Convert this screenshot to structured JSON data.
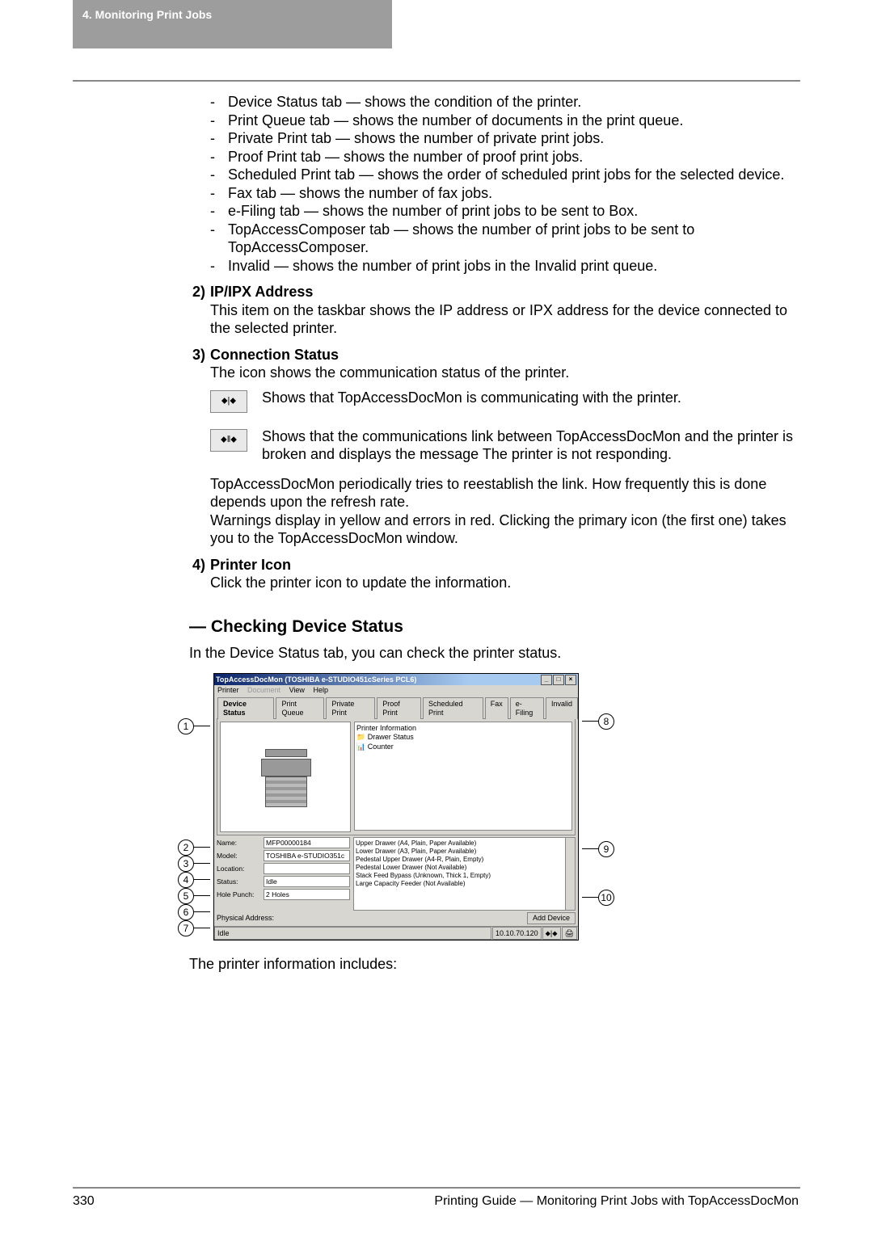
{
  "header": "4. Monitoring Print Jobs",
  "bullets": [
    "Device Status tab — shows the condition of the printer.",
    "Print Queue tab — shows the number of documents in the print queue.",
    "Private Print tab — shows the number of private print jobs.",
    "Proof Print tab — shows the number of proof print jobs.",
    "Scheduled Print tab — shows the order of scheduled print jobs for the selected device.",
    "Fax tab — shows the number of fax jobs.",
    "e-Filing tab — shows the number of print jobs to be sent to Box.",
    "TopAccessComposer tab — shows the number of print jobs to be sent to TopAccessComposer.",
    "Invalid — shows the number of print jobs in the Invalid print queue."
  ],
  "s2": {
    "num": "2)",
    "title": "IP/IPX Address",
    "body": "This item on the taskbar shows the IP address or IPX address for the device connected to the selected printer."
  },
  "s3": {
    "num": "3)",
    "title": "Connection Status",
    "body": "The icon shows the communication status of the printer."
  },
  "icon1_text": "Shows that TopAccessDocMon is communicating with the printer.",
  "icon2_text": "Shows that the communications link between TopAccessDocMon and the printer is broken and displays the message The printer is not responding.",
  "s3_tail1": "TopAccessDocMon periodically tries to reestablish the link. How frequently this is done depends upon the refresh rate.",
  "s3_tail2": "Warnings display in yellow and errors in red. Clicking the primary icon (the first one) takes you to the TopAccessDocMon window.",
  "s4": {
    "num": "4)",
    "title": "Printer Icon",
    "body": "Click the printer icon to update the information."
  },
  "h2": "— Checking Device Status",
  "h2_sub": "In the Device Status tab, you can check the printer status.",
  "win": {
    "title": "TopAccessDocMon (TOSHIBA e-STUDIO451cSeries PCL6)",
    "menu": {
      "m1": "Printer",
      "m2": "Document",
      "m3": "View",
      "m4": "Help"
    },
    "tabs": [
      "Device Status",
      "Print Queue",
      "Private Print",
      "Proof Print",
      "Scheduled Print",
      "Fax",
      "e-Filing",
      "Invalid"
    ],
    "info_items": [
      "Printer Information",
      "Drawer Status",
      "Counter"
    ],
    "fields": {
      "name_l": "Name:",
      "name_v": "MFP00000184",
      "model_l": "Model:",
      "model_v": "TOSHIBA e-STUDIO351c",
      "loc_l": "Location:",
      "loc_v": "",
      "status_l": "Status:",
      "status_v": "Idle",
      "hole_l": "Hole Punch:",
      "hole_v": "2 Holes",
      "phys_l": "Physical Address:"
    },
    "drawer": [
      "Upper Drawer (A4, Plain, Paper Available)",
      "Lower Drawer (A3, Plain, Paper Available)",
      "Pedestal Upper Drawer (A4-R, Plain, Empty)",
      "Pedestal Lower Drawer (Not Available)",
      "Stack Feed Bypass (Unknown, Thick 1, Empty)",
      "Large Capacity Feeder (Not Available)"
    ],
    "add": "Add Device",
    "status_left": "Idle",
    "ip": "10.10.70.120"
  },
  "after_shot": "The printer information includes:",
  "footer": {
    "page": "330",
    "right": "Printing Guide — Monitoring Print Jobs with TopAccessDocMon"
  }
}
